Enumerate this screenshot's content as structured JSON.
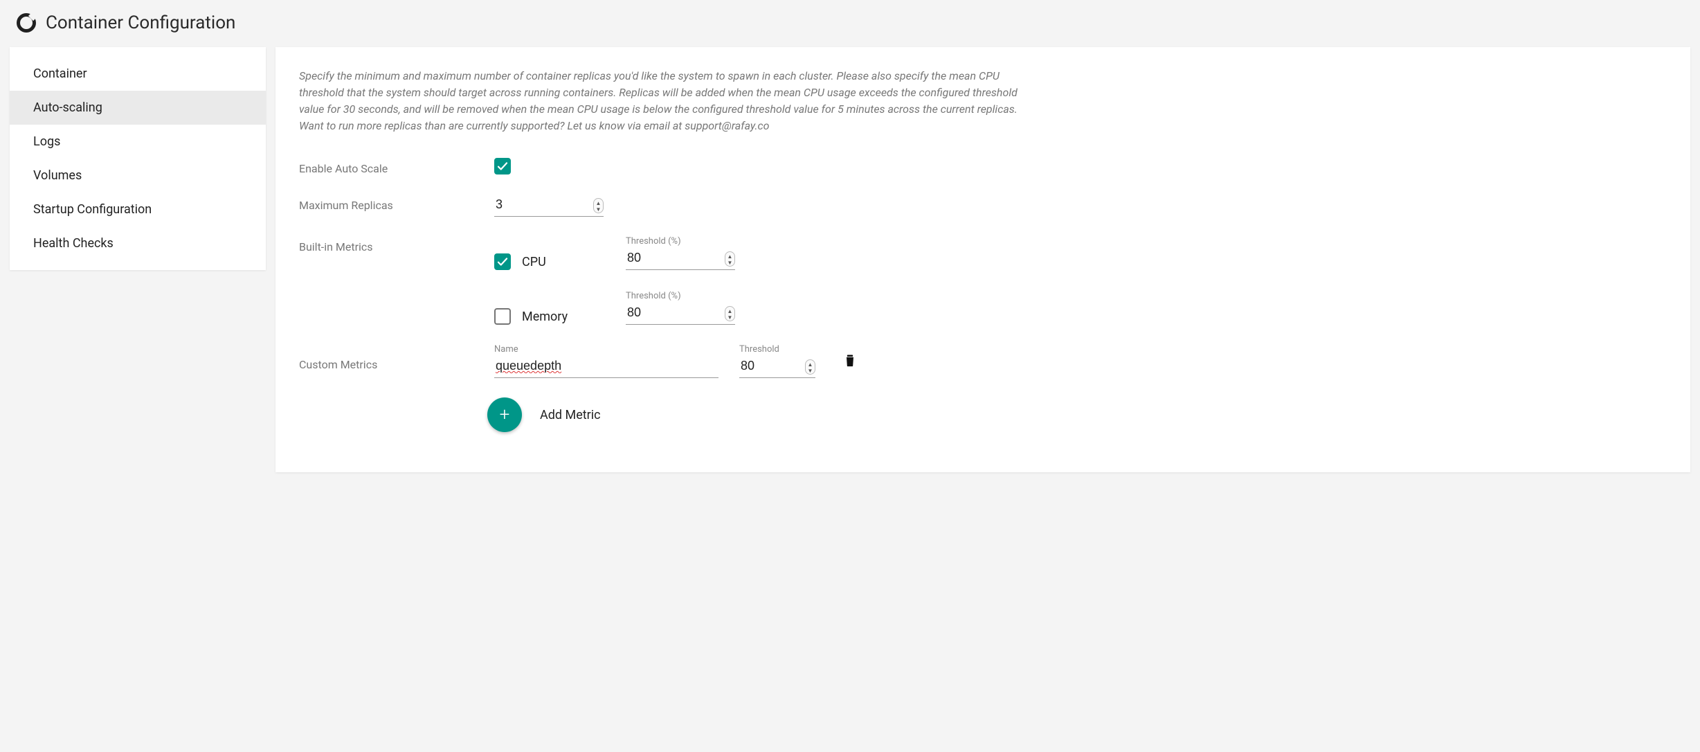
{
  "colors": {
    "accent": "#009688"
  },
  "header": {
    "title": "Container Configuration"
  },
  "sidebar": {
    "items": [
      {
        "label": "Container",
        "active": false
      },
      {
        "label": "Auto-scaling",
        "active": true
      },
      {
        "label": "Logs",
        "active": false
      },
      {
        "label": "Volumes",
        "active": false
      },
      {
        "label": "Startup Configuration",
        "active": false
      },
      {
        "label": "Health Checks",
        "active": false
      }
    ]
  },
  "description": "Specify the minimum and maximum number of container replicas you'd like the system to spawn in each cluster. Please also specify the mean CPU threshold that the system should target across running containers. Replicas will be added when the mean CPU usage exceeds the configured threshold value for 30 seconds, and will be removed when the mean CPU usage is below the configured threshold value for 5 minutes across the current replicas. Want to run more replicas than are currently supported? Let us know via email at support@rafay.co",
  "form": {
    "enable_label": "Enable Auto Scale",
    "enable_checked": true,
    "max_replicas_label": "Maximum Replicas",
    "max_replicas_value": "3",
    "builtin_label": "Built-in Metrics",
    "threshold_caption": "Threshold (%)",
    "cpu": {
      "label": "CPU",
      "checked": true,
      "threshold": "80"
    },
    "memory": {
      "label": "Memory",
      "checked": false,
      "threshold": "80"
    },
    "custom_label": "Custom Metrics",
    "custom_name_caption": "Name",
    "custom_threshold_caption": "Threshold",
    "custom": {
      "name": "queuedepth",
      "threshold": "80"
    },
    "add_metric_label": "Add Metric"
  }
}
